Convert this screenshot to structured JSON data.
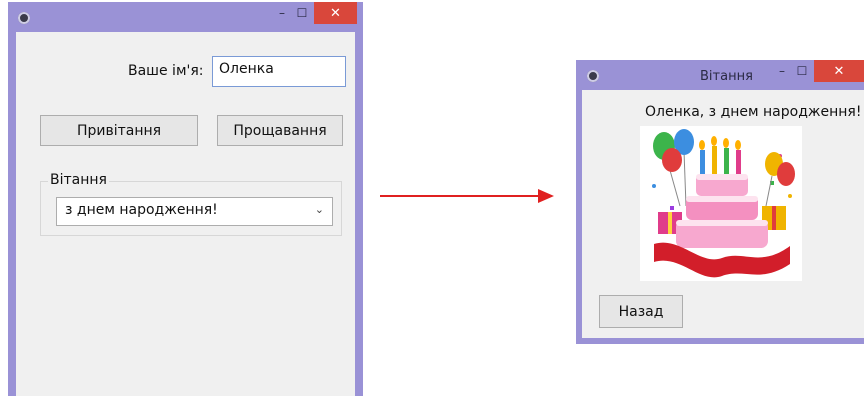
{
  "main_window": {
    "title": "",
    "minimize_glyph": "–",
    "maximize_glyph": "☐",
    "close_glyph": "✕",
    "name_label": "Ваше ім'я:",
    "name_value": "Оленка",
    "greet_button": "Привітання",
    "farewell_button": "Прощавання",
    "group_title": "Вітання",
    "greeting_select": "з днем народження!"
  },
  "arrow": {
    "color": "#e02020"
  },
  "greeting_window": {
    "title": "Вітання",
    "minimize_glyph": "–",
    "maximize_glyph": "☐",
    "close_glyph": "✕",
    "message": "Оленка, з днем народження!",
    "image_icon": "birthday-cake-icon",
    "back_button": "Назад"
  },
  "colors": {
    "titlebar": "#9a92d6",
    "close": "#d9473b",
    "client": "#f0f0f0"
  }
}
